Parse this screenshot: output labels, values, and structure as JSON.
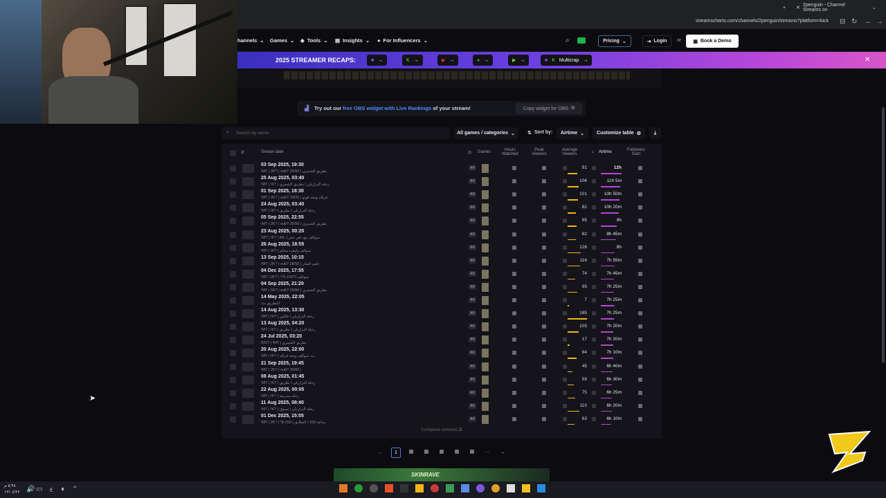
{
  "browser": {
    "tab_title": "2penguin - Channel Streams on",
    "url": "streamscharts.com/channels/2penguin/streams?platform=kick"
  },
  "nav": {
    "items": [
      "hannels",
      "Games",
      "Tools",
      "Insights",
      "For Influencers"
    ],
    "pricing": "Pricing",
    "login": "Login",
    "or": "or",
    "demo": "Book a Demo"
  },
  "recap": {
    "title": "2025 STREAMER RECAPS:",
    "multi": "Multicrap"
  },
  "promo": {
    "prefix": "Try out our",
    "link": "free OBS widget with Live Rankings",
    "suffix": "of your stream!",
    "button": "Copy widget for OBS"
  },
  "filters": {
    "search_placeholder": "Search by name",
    "games": "All games / categories",
    "sort_label": "Sort by:",
    "sort_value": "Airtime",
    "customize": "Customize table"
  },
  "columns": {
    "date": "Stream date",
    "games": "Games",
    "hours": "Hours Watched",
    "peak": "Peak Viewers",
    "avg": "Average Viewers",
    "airtime": "Airtime",
    "followers": "Followers Gain"
  },
  "rows": [
    {
      "date": "03 Sep 2025, 19:30",
      "title": "!MT | 2K? | sub? 25/50 | بطريق الشمري",
      "lang": "AR",
      "avg": "91",
      "airtime": "12h"
    },
    {
      "date": "25 Aug 2025, 03:40",
      "title": "!MT | !K? | رحلة البرازيلي | بطريق الشمري",
      "lang": "AR",
      "avg": "106",
      "airtime": "11h 5m"
    },
    {
      "date": "01 Sep 2025, 18:30",
      "title": "!MT | 2K? | sub? 19/25 | فراقد وبجه فوتو",
      "lang": "AR",
      "avg": "101",
      "airtime": "10h 50m"
    },
    {
      "date": "24 Aug 2025, 03:40",
      "title": "!MT | !K? | رحلة البرازيلي | بطريق",
      "lang": "AR",
      "avg": "82",
      "airtime": "10h 20m"
    },
    {
      "date": "05 Sep 2025, 22:55",
      "title": "!MT | 2K? | sub? 25/50 | بطريق الشمري",
      "lang": "AR",
      "avg": "85",
      "airtime": "9h"
    },
    {
      "date": "23 Aug 2025, 00:20",
      "title": "!MT | !K? | IRL | سوالف مع عفر عمر",
      "lang": "AR",
      "avg": "82",
      "airtime": "8h 45m"
    },
    {
      "date": "26 Aug 2025, 18:55",
      "title": "!MT | !K? | سوالف وليقت معكم",
      "lang": "AR",
      "avg": "126",
      "airtime": "8h"
    },
    {
      "date": "13 Sep 2025, 10:15",
      "title": "!MT | 2K? | sub? 28/50 | حليم الشار",
      "lang": "AR",
      "avg": "116",
      "airtime": "7h 55m"
    },
    {
      "date": "04 Dec 2025, 17:55",
      "title": "!MT | 2K? | !7h 150?| سوالف",
      "lang": "AR",
      "avg": "74",
      "airtime": "7h 45m"
    },
    {
      "date": "04 Sep 2025, 21:20",
      "title": "!MT | 2K? | sub? 25/50 | بطريق الشمري",
      "lang": "AR",
      "avg": "95",
      "airtime": "7h 25m"
    },
    {
      "date": "14 May 2025, 22:05",
      "title": "البطريق بث",
      "lang": "AR",
      "avg": "7",
      "airtime": "7h 25m"
    },
    {
      "date": "14 Aug 2025, 13:30",
      "title": "!MT | !K? | رحلة البرازيلي | فلكين",
      "lang": "AR",
      "avg": "185",
      "airtime": "7h 25m"
    },
    {
      "date": "13 Aug 2025, 04:20",
      "title": "!MT | !K? | رحلة البرازيلي | بطريق",
      "lang": "AR",
      "avg": "105",
      "airtime": "7h 20m"
    },
    {
      "date": "24 Jul 2025, 03:20",
      "title": "500? | !MT | بطريق الشمري",
      "lang": "AR",
      "avg": "17",
      "airtime": "7h 20m"
    },
    {
      "date": "20 Aug 2025, 22:00",
      "title": "!MT | !K? | بث سوالف وبجه فراقد",
      "lang": "AR",
      "avg": "84",
      "airtime": "7h 10m"
    },
    {
      "date": "21 Sep 2025, 19:45",
      "title": "!MT | 2K? | sub? 30/50 |",
      "lang": "AR",
      "avg": "45",
      "airtime": "6h 40m"
    },
    {
      "date": "08 Aug 2025, 01:45",
      "title": "!MT | !K? | رحلة البرازيلي | بطريق",
      "lang": "AR",
      "avg": "59",
      "airtime": "6h 30m"
    },
    {
      "date": "22 Aug 2025, 00:05",
      "title": "!MT | !K? | رحلة مدرسة",
      "lang": "AR",
      "avg": "75",
      "airtime": "6h 25m"
    },
    {
      "date": "11 Aug 2025, 08:40",
      "title": "!MT | !K? | رحلة البرازيلي | تسوق",
      "lang": "AR",
      "avg": "110",
      "airtime": "6h 20m"
    },
    {
      "date": "01 Dec 2025, 15:05",
      "title": "!MT | 2K? | !$-150 | ساعة 150 | التطابق",
      "lang": "AR",
      "avg": "63",
      "airtime": "6h 10m"
    }
  ],
  "footer": {
    "compose": "Compose streams",
    "page": "1",
    "ellipsis": "..."
  },
  "taskbar": {
    "time": "٥:٩٨ م",
    "date": "١٢/٠٤/٢٢",
    "lang": "ع"
  },
  "ad": {
    "text": "SKINRAVE"
  }
}
